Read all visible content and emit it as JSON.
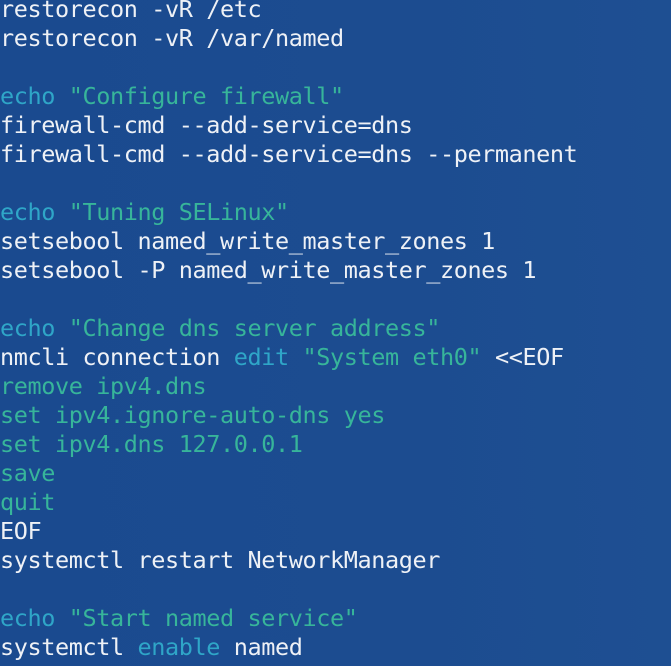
{
  "terminal": {
    "colors": {
      "background": "#1b4a8e",
      "text": "#eef1f6",
      "keyword": "#2fa6c8",
      "string": "#37b59a"
    },
    "lines": [
      [
        {
          "t": "restorecon -vR /etc",
          "c": "normal"
        }
      ],
      [
        {
          "t": "restorecon -vR /var/named",
          "c": "normal"
        }
      ],
      [],
      [
        {
          "t": "echo",
          "c": "kw"
        },
        {
          "t": " ",
          "c": "normal"
        },
        {
          "t": "\"Configure firewall\"",
          "c": "str"
        }
      ],
      [
        {
          "t": "firewall-cmd --add-service=dns",
          "c": "normal"
        }
      ],
      [
        {
          "t": "firewall-cmd --add-service=dns --permanent",
          "c": "normal"
        }
      ],
      [],
      [
        {
          "t": "echo",
          "c": "kw"
        },
        {
          "t": " ",
          "c": "normal"
        },
        {
          "t": "\"Tuning SELinux\"",
          "c": "str"
        }
      ],
      [
        {
          "t": "setsebool named_write_master_zones 1",
          "c": "normal"
        }
      ],
      [
        {
          "t": "setsebool -P named_write_master_zones 1",
          "c": "normal"
        }
      ],
      [],
      [
        {
          "t": "echo",
          "c": "kw"
        },
        {
          "t": " ",
          "c": "normal"
        },
        {
          "t": "\"Change dns server address\"",
          "c": "str"
        }
      ],
      [
        {
          "t": "nmcli connection ",
          "c": "normal"
        },
        {
          "t": "edit",
          "c": "edit"
        },
        {
          "t": " ",
          "c": "normal"
        },
        {
          "t": "\"System eth0\"",
          "c": "str"
        },
        {
          "t": " <<EOF",
          "c": "normal"
        }
      ],
      [
        {
          "t": "remove ipv4.dns",
          "c": "green"
        }
      ],
      [
        {
          "t": "set ipv4.ignore-auto-dns yes",
          "c": "green"
        }
      ],
      [
        {
          "t": "set ipv4.dns 127.0.0.1",
          "c": "green"
        }
      ],
      [
        {
          "t": "save",
          "c": "green"
        }
      ],
      [
        {
          "t": "quit",
          "c": "green"
        }
      ],
      [
        {
          "t": "EOF",
          "c": "normal"
        }
      ],
      [
        {
          "t": "systemctl restart NetworkManager",
          "c": "normal"
        }
      ],
      [],
      [
        {
          "t": "echo",
          "c": "kw"
        },
        {
          "t": " ",
          "c": "normal"
        },
        {
          "t": "\"Start named service\"",
          "c": "str"
        }
      ],
      [
        {
          "t": "systemctl ",
          "c": "normal"
        },
        {
          "t": "enable",
          "c": "kw"
        },
        {
          "t": " named",
          "c": "normal"
        }
      ]
    ]
  }
}
